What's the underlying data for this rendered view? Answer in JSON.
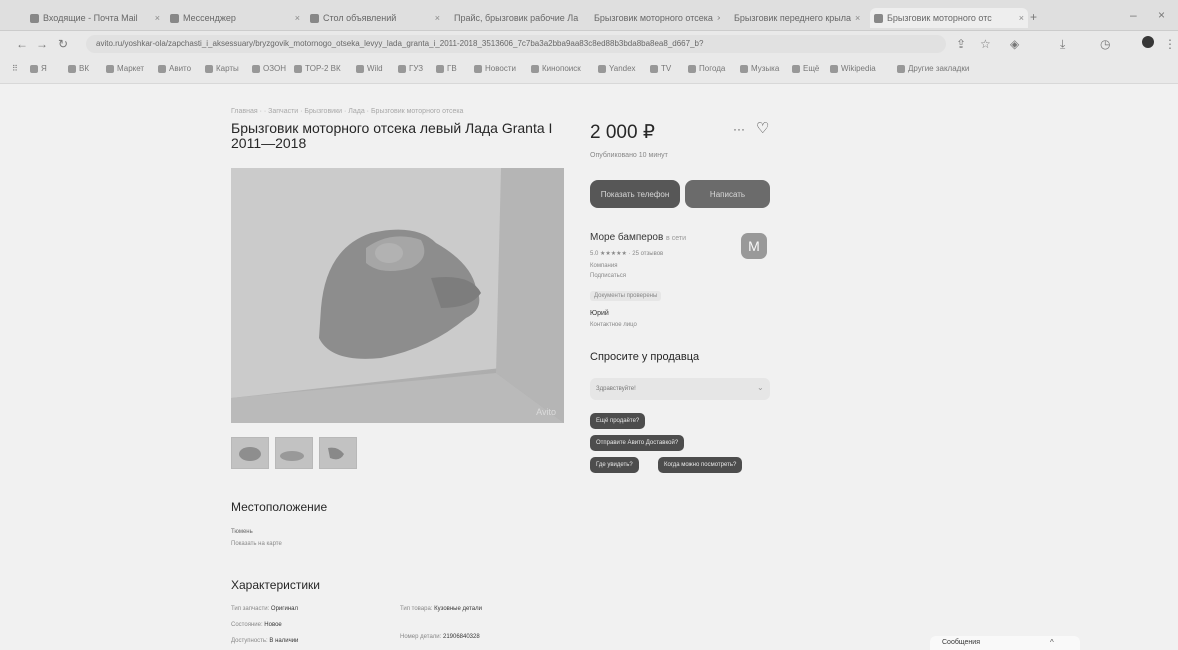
{
  "browser": {
    "tabs": [
      {
        "label": "Входящие - Почта Mail"
      },
      {
        "label": "Мессенджер"
      },
      {
        "label": "Стол объявлений"
      },
      {
        "label": "Прайс, брызговик рабочие Ла"
      },
      {
        "label": "Брызговик моторного отсека"
      },
      {
        "label": "Брызговик переднего крыла"
      },
      {
        "label": "Брызговик моторного отс"
      }
    ],
    "url": "avito.ru/yoshkar-ola/zapchasti_i_aksessuary/bryzgovik_motornogo_otseka_levyy_lada_granta_i_2011-2018_3513606_7c7ba3a2bba9aa83c8ed88b3bda8ba8ea8_d667_b?",
    "bookmarks": [
      "Я",
      "ВК",
      "Маркет",
      "Авито",
      "Карты",
      "ОЗОН",
      "TOP-2 ВК",
      "Wild",
      "ГУЗ",
      "ГВ",
      "Новости",
      "Кинопоиск",
      "Yandex",
      "TV",
      "Погода",
      "Музыка",
      "Ещё",
      "Wikipedia",
      "Другие закладки"
    ]
  },
  "listing": {
    "breadcrumb": "Главная · · Запчасти · Брызговики · Лада · Брызговик моторного отсека",
    "title": "Брызговик моторного отсека левый Лада Granta I 2011—2018",
    "price": "2 000 ₽",
    "more_label": "···",
    "date_text": "Опубликовано 10 минут",
    "show_phone_label": "Показать телефон",
    "write_label": "Написать",
    "thumbnails": [
      "Фото 1",
      "Фото 2",
      "Фото 3"
    ]
  },
  "seller": {
    "name": "Море бамперов",
    "rating_text": "5.0 ★★★★★ · 25 отзывов",
    "type": "Компания",
    "subscribe_text": "Подписаться",
    "docs_badge": "Документы проверены",
    "contact_name": "Юрий",
    "contact_role": "Контактное лицо",
    "avatar_letter": "M",
    "online_label": "в сети"
  },
  "ask": {
    "heading": "Спросите у продавца",
    "input_placeholder": "Здравствуйте!",
    "chips": [
      "Ещё продаёте?",
      "Отправите Авито Доставкой?",
      "Где увидеть?",
      "Когда можно посмотреть?"
    ]
  },
  "location": {
    "heading": "Местоположение",
    "city": "Тюмень",
    "link": "Показать на карте"
  },
  "specs": {
    "heading": "Характеристики",
    "rows_left": [
      {
        "label": "Тип запчасти:",
        "value": "Оригинал"
      },
      {
        "label": "Состояние:",
        "value": "Новое"
      },
      {
        "label": "Доступность:",
        "value": "В наличии"
      }
    ],
    "rows_right": [
      {
        "label": "Тип товара:",
        "value": "Кузовные детали"
      },
      {
        "label": "Номер детали:",
        "value": "21906840328"
      }
    ]
  },
  "footer": {
    "messages_label": "Сообщения",
    "arrow": "^"
  },
  "colors": {
    "accent": "#555555",
    "bg": "#f7f7f7"
  }
}
